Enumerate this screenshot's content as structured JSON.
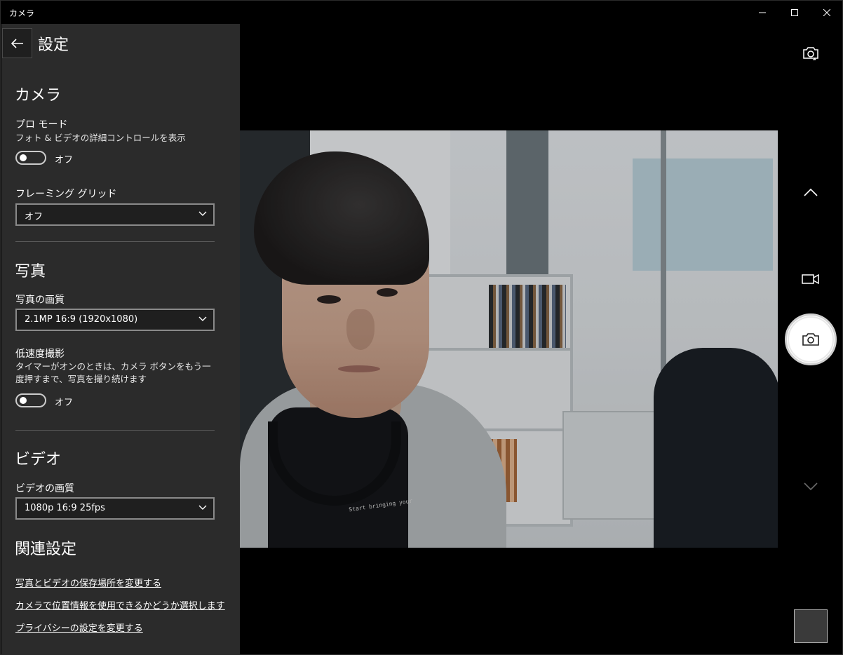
{
  "window": {
    "title": "カメラ"
  },
  "panel": {
    "title": "設定",
    "camera_section": {
      "title": "カメラ",
      "pro_mode": {
        "label": "プロ モード",
        "description": "フォト & ビデオの詳細コントロールを表示",
        "state": "オフ"
      },
      "framing_grid": {
        "label": "フレーミング グリッド",
        "value": "オフ"
      }
    },
    "photo_section": {
      "title": "写真",
      "photo_quality": {
        "label": "写真の画質",
        "value": "2.1MP 16:9 (1920x1080)"
      },
      "time_lapse": {
        "label": "低速度撮影",
        "description": "タイマーがオンのときは、カメラ ボタンをもう一度押すまで、写真を撮り続けます",
        "state": "オフ"
      }
    },
    "video_section": {
      "title": "ビデオ",
      "video_quality": {
        "label": "ビデオの画質",
        "value": "1080p 16:9 25fps"
      }
    },
    "related_section": {
      "title": "関連設定",
      "links": [
        "写真とビデオの保存場所を変更する",
        "カメラで位置情報を使用できるかどうか選択します",
        "プライバシーの設定を変更する"
      ]
    }
  },
  "viewport": {
    "shirt_text": "Start bringing your"
  },
  "icons": {
    "back": "back-arrow-icon",
    "switch_camera": "switch-camera-icon",
    "chevron_up": "chevron-up-icon",
    "video_mode": "video-camera-icon",
    "photo_shutter": "camera-icon",
    "chevron_down": "chevron-down-icon"
  },
  "colors": {
    "panel_bg": "#2b2b2b",
    "app_bg": "#000000",
    "shutter_bg": "#ffffff"
  }
}
